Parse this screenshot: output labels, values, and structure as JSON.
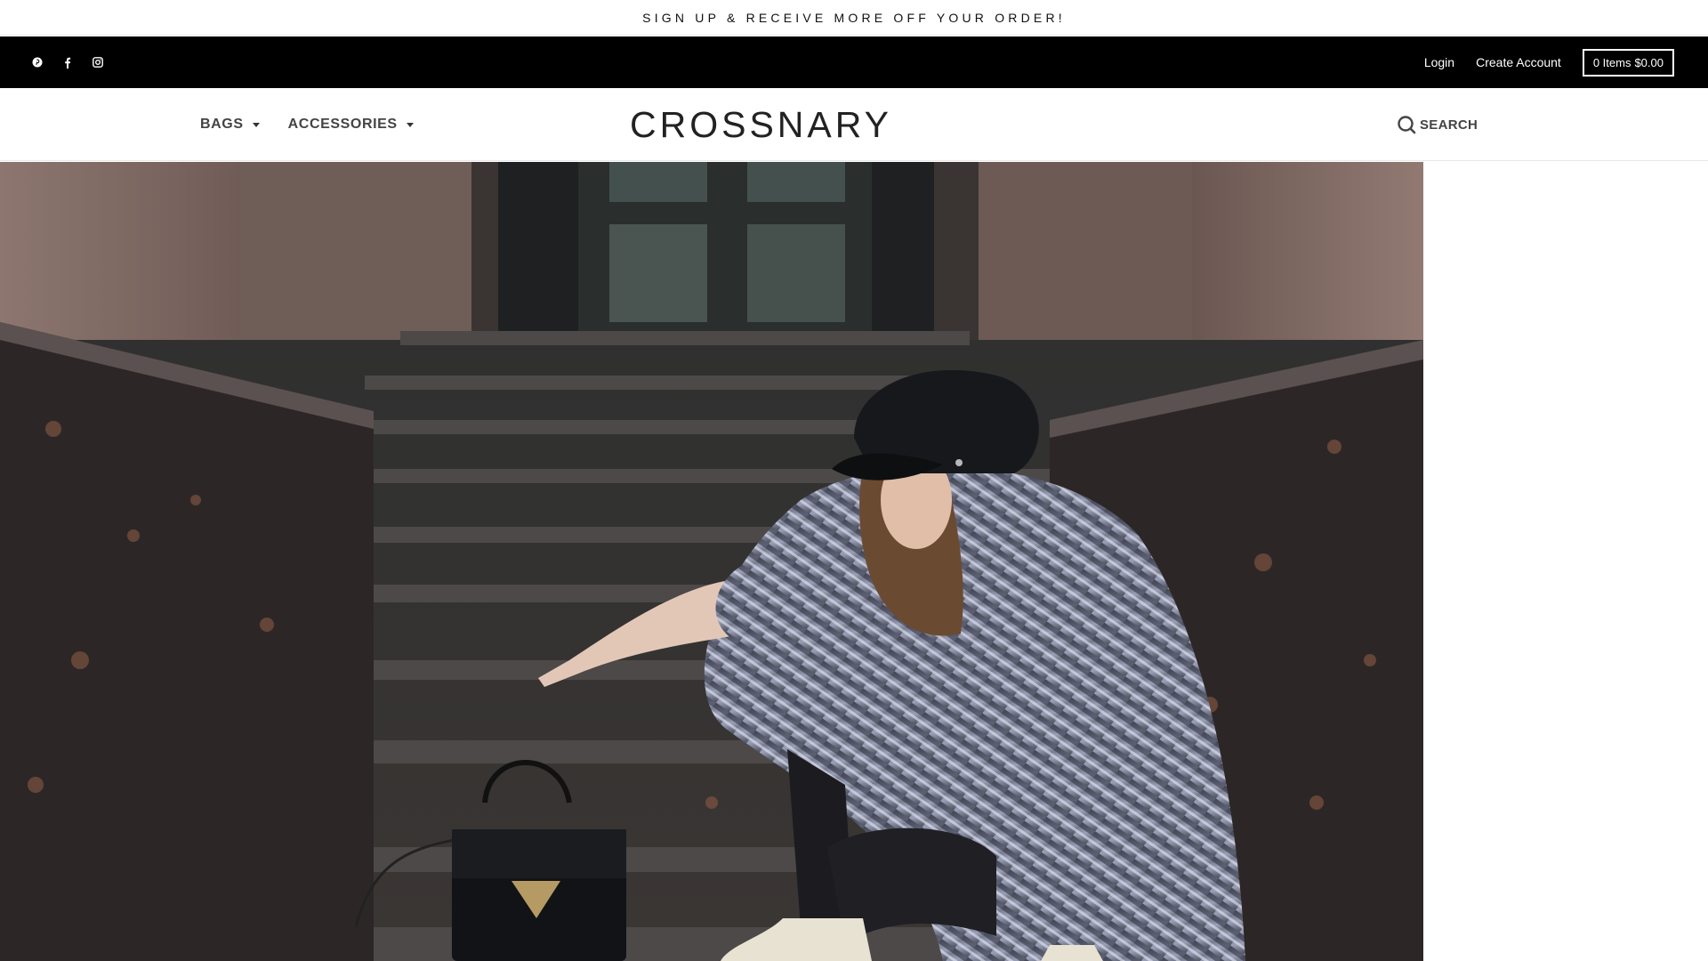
{
  "announcement": {
    "text": "SIGN UP & RECEIVE MORE OFF YOUR ORDER!"
  },
  "topbar": {
    "social": [
      "pinterest-icon",
      "facebook-icon",
      "instagram-icon"
    ],
    "login_label": "Login",
    "create_account_label": "Create Account",
    "cart": {
      "items": "0 Items",
      "total": "$0.00"
    }
  },
  "nav": {
    "items": [
      {
        "label": "BAGS"
      },
      {
        "label": "ACCESSORIES"
      }
    ],
    "logo": "CROSSNARY",
    "search_label": "SEARCH"
  },
  "colors": {
    "topbar_bg": "#000000",
    "page_bg": "#ffffff",
    "text": "#444444"
  }
}
